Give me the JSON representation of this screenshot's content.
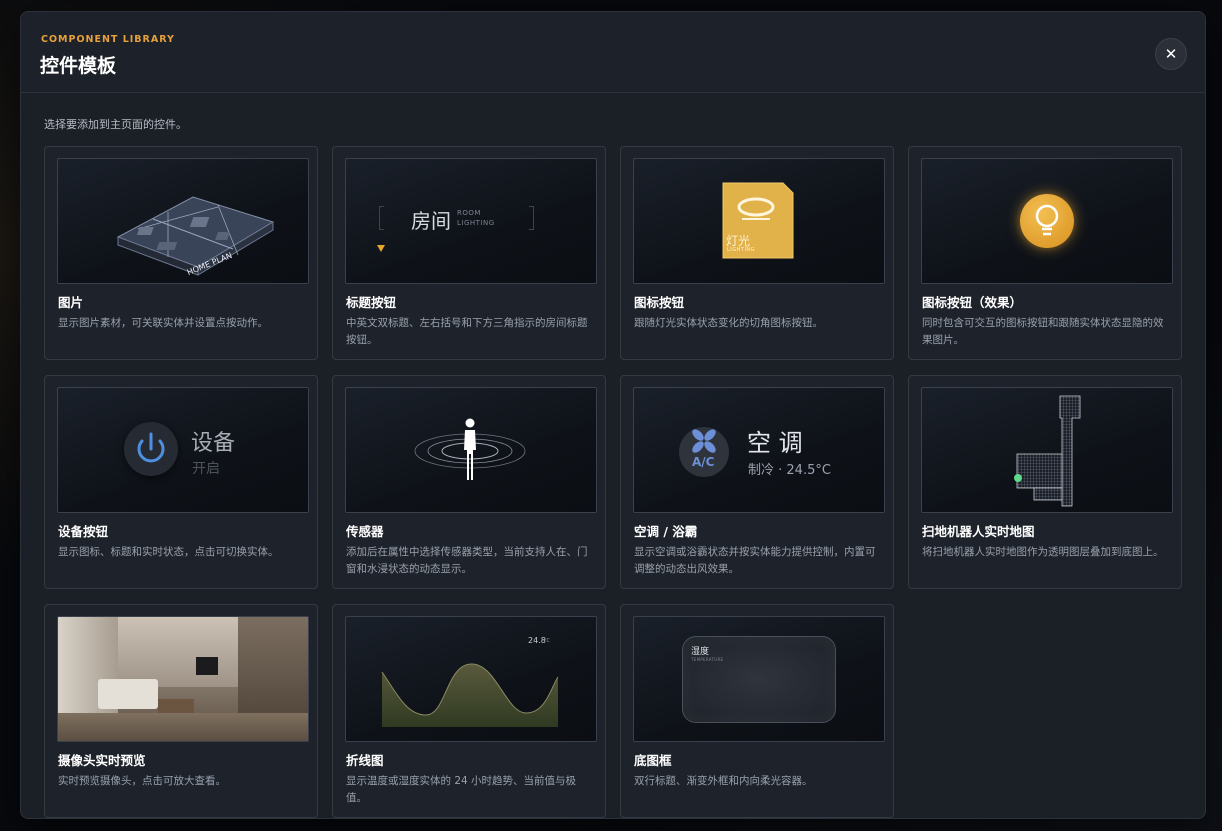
{
  "header": {
    "eyebrow": "COMPONENT LIBRARY",
    "title": "控件模板",
    "close_icon": "close-icon"
  },
  "subtitle": "选择要添加到主页面的控件。",
  "cards": [
    {
      "name": "图片",
      "desc": "显示图片素材，可关联实体并设置点按动作。",
      "thumb": {
        "caption": "HOME PLAN"
      }
    },
    {
      "name": "标题按钮",
      "desc": "中英文双标题、左右括号和下方三角指示的房间标题按钮。",
      "thumb": {
        "cn": "房间",
        "en1": "ROOM",
        "en2": "LIGHTING"
      }
    },
    {
      "name": "图标按钮",
      "desc": "跟随灯光实体状态变化的切角图标按钮。",
      "thumb": {
        "cn": "灯光",
        "en": "LIGHTING",
        "color": "#e2b24a"
      }
    },
    {
      "name": "图标按钮（效果）",
      "desc": "同时包含可交互的图标按钮和跟随实体状态显隐的效果图片。",
      "thumb": {
        "icon": "lightbulb-icon",
        "color": "#e8a530"
      }
    },
    {
      "name": "设备按钮",
      "desc": "显示图标、标题和实时状态，点击可切换实体。",
      "thumb": {
        "title": "设备",
        "state": "开启",
        "icon": "power-icon",
        "color": "#4f8fe0"
      }
    },
    {
      "name": "传感器",
      "desc": "添加后在属性中选择传感器类型，当前支持人在、门窗和水浸状态的动态显示。",
      "thumb": {
        "icon": "person-icon"
      }
    },
    {
      "name": "空调 / 浴霸",
      "desc": "显示空调或浴霸状态并按实体能力提供控制，内置可调整的动态出风效果。",
      "thumb": {
        "title": "空 调",
        "state": "制冷 · 24.5°C",
        "badge": "A/C",
        "icon": "fan-icon",
        "color": "#6c8fd8"
      }
    },
    {
      "name": "扫地机器人实时地图",
      "desc": "将扫地机器人实时地图作为透明图层叠加到底图上。",
      "thumb": {
        "icon": "robot-map-icon"
      }
    },
    {
      "name": "摄像头实时预览",
      "desc": "实时预览摄像头，点击可放大查看。",
      "thumb": {
        "icon": "camera-preview"
      }
    },
    {
      "name": "折线图",
      "desc": "显示温度或湿度实体的 24 小时趋势、当前值与极值。",
      "thumb": {
        "value": "24.8",
        "unit": "°C"
      }
    },
    {
      "name": "底图框",
      "desc": "双行标题、渐变外框和内向柔光容器。",
      "thumb": {
        "cn": "湿度",
        "en": "TEMPERATURE"
      }
    }
  ]
}
